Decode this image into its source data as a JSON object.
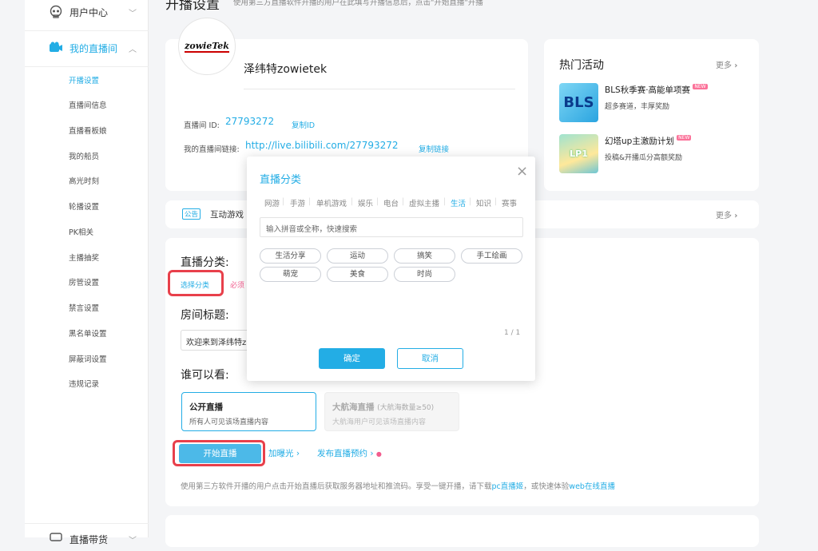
{
  "page": {
    "title": "开播设置",
    "subtitle": "使用第三方直播软件开播的用户在此填写开播信息后，点击\"开始直播\"开播"
  },
  "sidebar": {
    "user_center": "用户中心",
    "my_live_room": "我的直播间",
    "items": [
      {
        "label": "开播设置",
        "active": true
      },
      {
        "label": "直播间信息"
      },
      {
        "label": "直播看板娘"
      },
      {
        "label": "我的船员"
      },
      {
        "label": "高光时刻"
      },
      {
        "label": "轮播设置"
      },
      {
        "label": "PK相关"
      },
      {
        "label": "主播抽奖"
      },
      {
        "label": "房管设置"
      },
      {
        "label": "禁言设置"
      },
      {
        "label": "黑名单设置"
      },
      {
        "label": "屏蔽词设置"
      },
      {
        "label": "违规记录"
      }
    ],
    "bottom_item": "直播带货"
  },
  "profile": {
    "logo_text": "zowieTek",
    "name": "泽纬特zowietek",
    "room_id_label": "直播间 ID:",
    "room_id": "27793272",
    "copy_id": "复制ID",
    "link_label": "我的直播间链接:",
    "link": "http://live.bilibili.com/27793272",
    "copy_link": "复制链接"
  },
  "hot": {
    "title": "热门活动",
    "more": "更多",
    "items": [
      {
        "thumb": "BLS",
        "title": "BLS秋季赛·高能单项赛",
        "badge": "NEW",
        "desc": "超多赛道，丰厚奖励"
      },
      {
        "thumb": "LP1",
        "title": "幻塔up主激励计划",
        "badge": "NEW",
        "desc": "投稿&开播瓜分高额奖励"
      }
    ]
  },
  "notice": {
    "tag": "公告",
    "text": "互动游戏",
    "more": "更多"
  },
  "settings": {
    "category_label": "直播分类:",
    "choose_category": "选择分类",
    "required": "必须",
    "title_label": "房间标题:",
    "title_value": "欢迎来到泽纬特z",
    "who_label": "谁可以看:",
    "public_title": "公开直播",
    "public_desc": "所有人可见该场直播内容",
    "private_title": "大航海直播",
    "private_hint": "(大航海数量≥50)",
    "private_desc": "大航海用户可见该场直播内容",
    "start": "开始直播",
    "boost": "加曝光",
    "reserve": "发布直播预约",
    "footer_a": "使用第三方软件开播的用户点击开始直播后获取服务器地址和推流码。享受一键开播，请下载",
    "footer_link1": "pc直播姬",
    "footer_b": "，或快速体验",
    "footer_link2": "web在线直播"
  },
  "modal": {
    "title": "直播分类",
    "tabs": [
      "网游",
      "手游",
      "单机游戏",
      "娱乐",
      "电台",
      "虚拟主播",
      "生活",
      "知识",
      "赛事"
    ],
    "active_tab": "生活",
    "search_placeholder": "输入拼音或全称，快速搜索",
    "tags": [
      "生活分享",
      "运动",
      "搞笑",
      "手工绘画",
      "萌宠",
      "美食",
      "时尚"
    ],
    "page": "1 / 1",
    "confirm": "确定",
    "cancel": "取消"
  },
  "colors": {
    "accent": "#23ade5",
    "highlight": "#e8404b"
  }
}
